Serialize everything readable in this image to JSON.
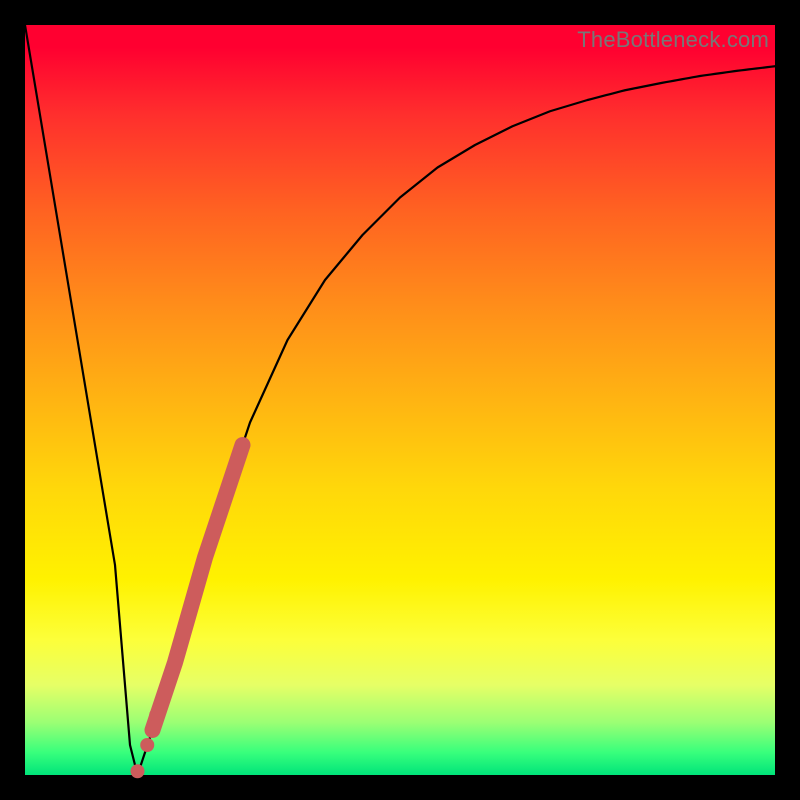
{
  "watermark": "TheBottleneck.com",
  "chart_data": {
    "type": "line",
    "title": "",
    "xlabel": "",
    "ylabel": "",
    "xlim": [
      0,
      100
    ],
    "ylim": [
      0,
      100
    ],
    "x": [
      0,
      2,
      4,
      6,
      8,
      10,
      12,
      13,
      14,
      15,
      16,
      18,
      20,
      22,
      24,
      26,
      28,
      30,
      35,
      40,
      45,
      50,
      55,
      60,
      65,
      70,
      75,
      80,
      85,
      90,
      95,
      100
    ],
    "y": [
      100,
      88,
      76,
      64,
      52,
      40,
      28,
      16,
      4,
      0,
      3,
      9,
      15,
      22,
      29,
      35,
      41,
      47,
      58,
      66,
      72,
      77,
      81,
      84,
      86.5,
      88.5,
      90,
      91.3,
      92.3,
      93.2,
      93.9,
      94.5
    ],
    "highlight_segment": {
      "x_start": 17,
      "x_end": 29,
      "color": "#cd5c5c"
    },
    "markers": [
      {
        "x": 15.0,
        "y": 0.5
      },
      {
        "x": 16.3,
        "y": 4.0
      },
      {
        "x": 17.5,
        "y": 8.0
      }
    ],
    "background_gradient": [
      "#ff0030",
      "#ff8c1a",
      "#fff200",
      "#00e47a"
    ],
    "grid": false,
    "legend": false
  }
}
